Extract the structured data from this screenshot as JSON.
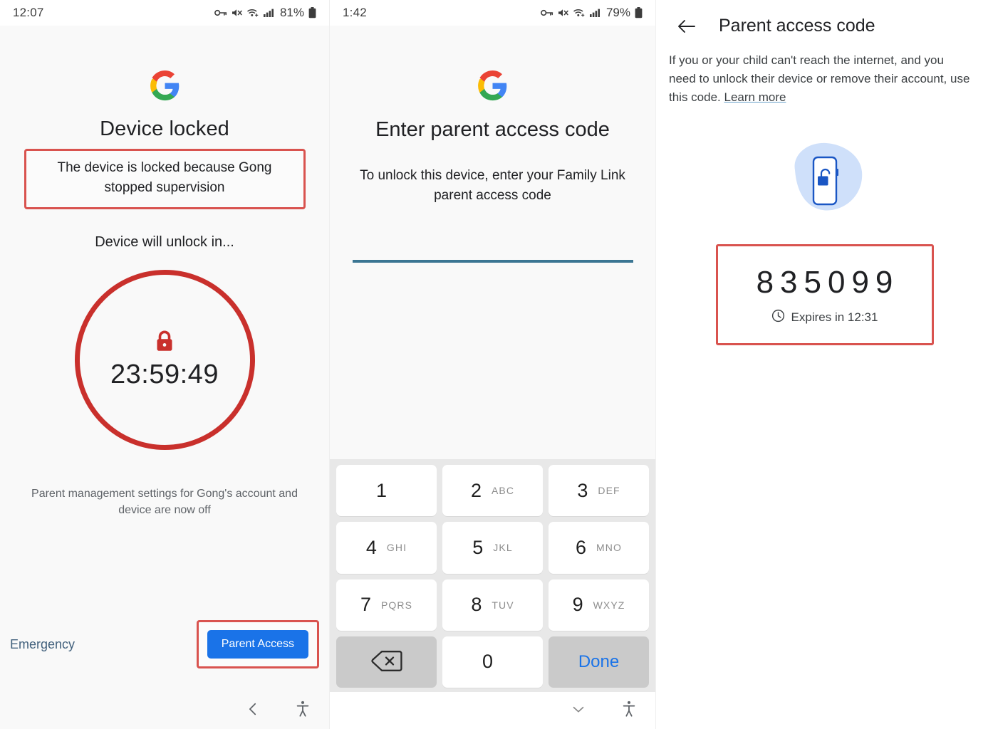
{
  "panel1": {
    "status_bar": {
      "time": "12:07",
      "battery": "81%",
      "icons": [
        "vpn-key-icon",
        "mute-icon",
        "wifi-icon",
        "signal-icon",
        "battery-icon"
      ]
    },
    "logo": "google-logo",
    "title": "Device locked",
    "highlighted_message": "The device is locked because Gong stopped supervision",
    "unlock_label": "Device will unlock in...",
    "countdown": "23:59:49",
    "lock_icon": "lock-icon",
    "footer_note": "Parent management settings for Gong's account and device are now off",
    "emergency_label": "Emergency",
    "parent_access_button": "Parent Access",
    "nav": [
      "back-icon",
      "accessibility-icon"
    ],
    "colors": {
      "accent": "#1a73e8",
      "highlight": "#d9534f",
      "circle": "#c9302c"
    }
  },
  "panel2": {
    "status_bar": {
      "time": "1:42",
      "battery": "79%",
      "icons": [
        "vpn-key-icon",
        "mute-icon",
        "wifi-icon",
        "signal-icon",
        "battery-icon"
      ]
    },
    "logo": "google-logo",
    "title": "Enter parent access code",
    "subtitle": "To unlock this device, enter your Family Link parent access code",
    "input": {
      "value": "",
      "placeholder": ""
    },
    "keypad": [
      {
        "num": "1",
        "letters": ""
      },
      {
        "num": "2",
        "letters": "ABC"
      },
      {
        "num": "3",
        "letters": "DEF"
      },
      {
        "num": "4",
        "letters": "GHI"
      },
      {
        "num": "5",
        "letters": "JKL"
      },
      {
        "num": "6",
        "letters": "MNO"
      },
      {
        "num": "7",
        "letters": "PQRS"
      },
      {
        "num": "8",
        "letters": "TUV"
      },
      {
        "num": "9",
        "letters": "WXYZ"
      },
      {
        "num": "",
        "letters": "",
        "icon": "backspace-icon"
      },
      {
        "num": "0",
        "letters": ""
      },
      {
        "num": "",
        "letters": "",
        "label": "Done"
      }
    ],
    "done_label": "Done",
    "nav": [
      "chevron-down-icon",
      "accessibility-icon"
    ],
    "colors": {
      "underline": "#3b7693",
      "done": "#1a73e8",
      "keypad_bg": "#e8e8e8"
    }
  },
  "panel3": {
    "back_icon": "arrow-back-icon",
    "title": "Parent access code",
    "description_part1": "If you or your child can't reach the internet, and you need to unlock their device or remove their account, use this code. ",
    "learn_more": "Learn more",
    "illustration": "phone-unlock-icon",
    "code": "835099",
    "clock_icon": "clock-icon",
    "expires_label": "Expires in 12:31",
    "colors": {
      "illustration_bg": "#cfe0fa",
      "illustration_fg": "#1a56c4",
      "highlight": "#d9534f"
    }
  }
}
